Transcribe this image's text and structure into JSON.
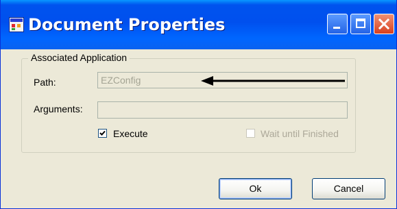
{
  "window": {
    "title": "Document Properties",
    "icon": "app-window-icon",
    "controls": {
      "minimize": "minimize-icon",
      "maximize": "maximize-icon",
      "close": "close-icon"
    },
    "colors": {
      "titlebar": "#0054e3",
      "face": "#ece9d8",
      "close": "#e0502a",
      "annotation_arrow": "#000000"
    }
  },
  "group": {
    "label": "Associated Application"
  },
  "path": {
    "label": "Path:",
    "value": "EZConfig"
  },
  "arguments": {
    "label": "Arguments:",
    "value": ""
  },
  "execute": {
    "label": "Execute",
    "checked": true
  },
  "wait": {
    "label": "Wait until Finished",
    "checked": false,
    "enabled": false
  },
  "buttons": {
    "ok": "Ok",
    "cancel": "Cancel"
  }
}
